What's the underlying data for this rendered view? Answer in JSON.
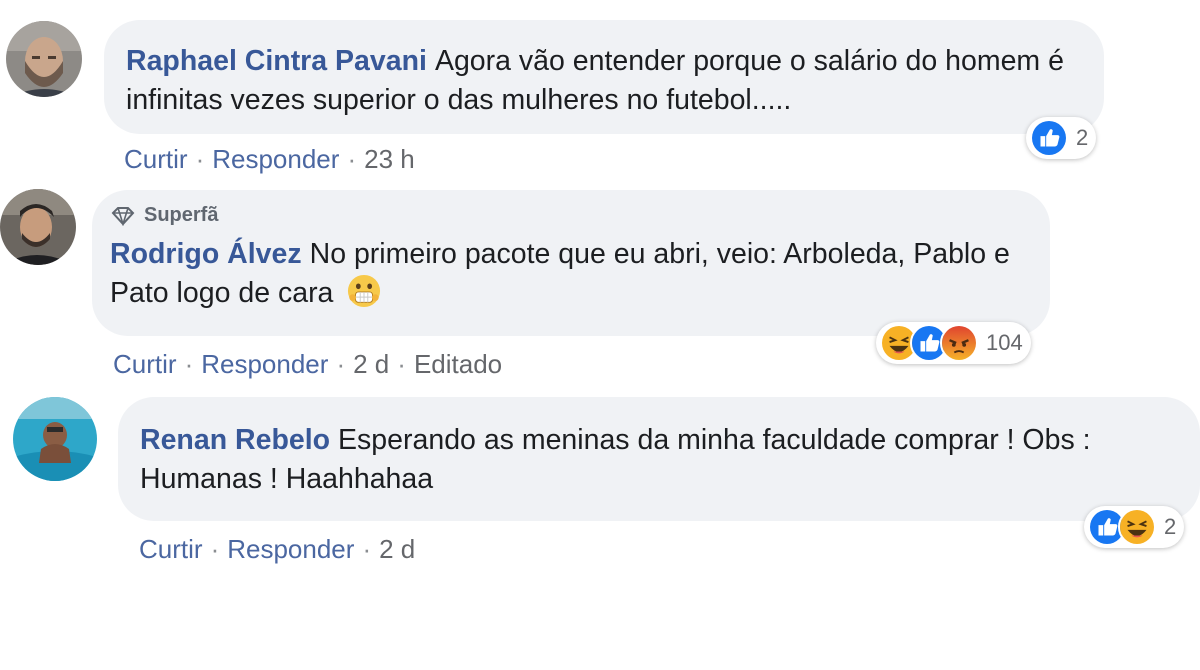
{
  "comments": [
    {
      "author": "Raphael Cintra Pavani",
      "badge": "",
      "text": "Agora vão entender porque o salário do homem é infinitas vezes superior o das mulheres no futebol.....",
      "actions": {
        "like": "Curtir",
        "reply": "Responder",
        "time": "23 h",
        "edited": ""
      },
      "reactions": {
        "icons": [
          "like-icon"
        ],
        "count": "2"
      }
    },
    {
      "author": "Rodrigo Álvez",
      "badge": "Superfã",
      "text": "No primeiro pacote que eu abri, veio: Arboleda, Pablo e Pato logo de cara",
      "emoji": "shocked-face-icon",
      "actions": {
        "like": "Curtir",
        "reply": "Responder",
        "time": "2 d",
        "edited": "Editado"
      },
      "reactions": {
        "icons": [
          "haha-icon",
          "like-icon",
          "angry-icon"
        ],
        "count": "104"
      }
    },
    {
      "author": "Renan Rebelo",
      "badge": "",
      "text": "Esperando as meninas da minha faculdade comprar ! Obs : Humanas ! Haahhahaa",
      "actions": {
        "like": "Curtir",
        "reply": "Responder",
        "time": "2 d",
        "edited": ""
      },
      "reactions": {
        "icons": [
          "like-icon",
          "haha-icon"
        ],
        "count": "2"
      }
    }
  ],
  "separator": "·",
  "colors": {
    "author": "#385898",
    "bubble": "#f0f2f5",
    "action_link": "#4b67a1",
    "like_blue": "#1877f2",
    "haha_yellow": "#f7b125",
    "angry_red": "#e9710f"
  }
}
